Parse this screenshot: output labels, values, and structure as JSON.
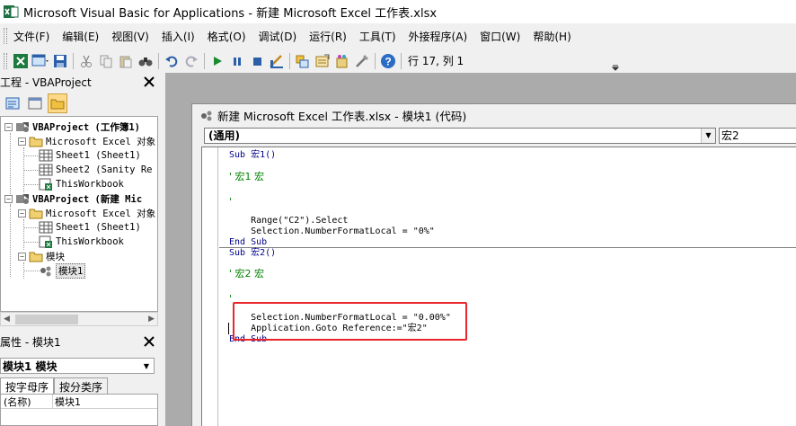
{
  "window": {
    "title": "Microsoft Visual Basic for Applications - 新建 Microsoft Excel 工作表.xlsx",
    "icon": "excel-vba-icon"
  },
  "menu": [
    "文件(F)",
    "编辑(E)",
    "视图(V)",
    "插入(I)",
    "格式(O)",
    "调试(D)",
    "运行(R)",
    "工具(T)",
    "外接程序(A)",
    "窗口(W)",
    "帮助(H)"
  ],
  "toolbar": {
    "buttons": [
      "view-excel-icon",
      "insert-userform-icon",
      "save-icon",
      "cut-icon",
      "copy-icon",
      "paste-icon",
      "find-icon",
      "undo-icon",
      "redo-icon",
      "run-icon",
      "break-icon",
      "reset-icon",
      "design-mode-icon",
      "project-explorer-icon",
      "properties-icon",
      "object-browser-icon",
      "toolbox-icon",
      "help-icon"
    ],
    "cursor_position": "行 17, 列 1"
  },
  "project_pane": {
    "title": "工程 - VBAProject",
    "tree": [
      {
        "label": "VBAProject (工作簿1)",
        "bold": true
      },
      {
        "label": "Microsoft Excel 对象"
      },
      {
        "label": "Sheet1 (Sheet1)"
      },
      {
        "label": "Sheet2 (Sanity Re"
      },
      {
        "label": "ThisWorkbook"
      },
      {
        "label": "VBAProject (新建 Mic",
        "bold": true
      },
      {
        "label": "Microsoft Excel 对象"
      },
      {
        "label": "Sheet1 (Sheet1)"
      },
      {
        "label": "ThisWorkbook"
      },
      {
        "label": "模块"
      },
      {
        "label": "模块1"
      }
    ]
  },
  "properties_pane": {
    "title": "属性 - 模块1",
    "object_select": "模块1 模块",
    "tabs": [
      "按字母序",
      "按分类序"
    ],
    "rows": [
      {
        "name": "(名称)",
        "value": "模块1"
      }
    ]
  },
  "code_window": {
    "title": "新建 Microsoft Excel 工作表.xlsx - 模块1 (代码)",
    "object_combo": "(通用)",
    "procedure_combo": "宏2",
    "lines": [
      "Sub 宏1()",
      "' 宏1 宏",
      "'",
      "    Range(\"C2\").Select",
      "    Selection.NumberFormatLocal = \"0%\"",
      "End Sub",
      "Sub 宏2()",
      "' 宏2 宏",
      "'",
      "    Selection.NumberFormatLocal = \"0.00%\"",
      "    Application.Goto Reference:=\"宏2\"",
      "End Sub"
    ]
  },
  "colors": {
    "comment": "#008000",
    "highlight_box": "#e8262d",
    "mdi_background": "#ababab"
  }
}
